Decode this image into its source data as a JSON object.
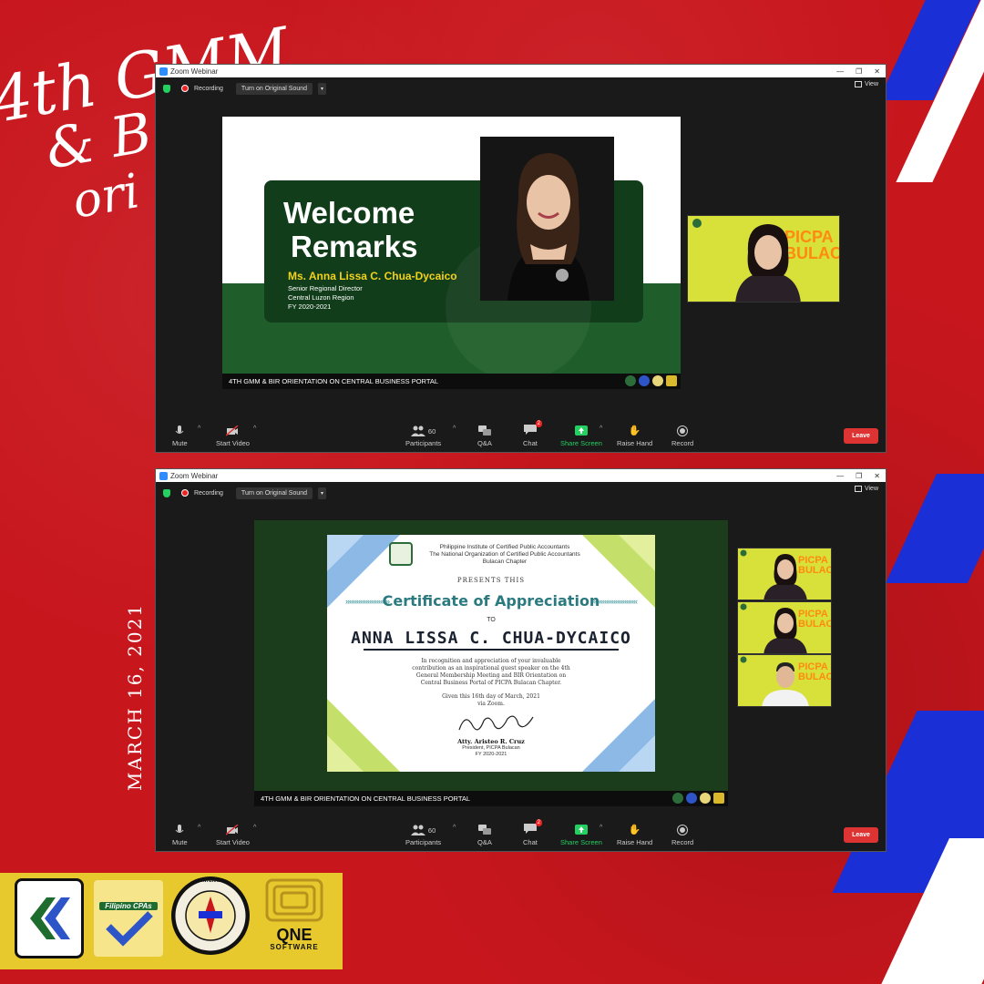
{
  "background": {
    "title_lines": [
      "4th GMM",
      "& B",
      "ori"
    ],
    "date": "MARCH 16, 2021",
    "accent_red": "#c8161d",
    "accent_blue": "#1a2fd6"
  },
  "window_top": {
    "app_title": "Zoom Webinar",
    "recording_label": "Recording",
    "original_sound_label": "Turn on Original Sound",
    "view_label": "View",
    "slide": {
      "heading_line1": "Welcome",
      "heading_line2": "Remarks",
      "speaker_name": "Ms. Anna Lissa C. Chua-Dycaico",
      "speaker_role1": "Senior Regional Director",
      "speaker_role2": "Central Luzon Region",
      "speaker_role3": "FY 2020-2021"
    },
    "banner_text": "4TH GMM & BIR ORIENTATION ON CENTRAL BUSINESS PORTAL",
    "thumb_label": "PICPA BULACAN",
    "toolbar": {
      "mute": "Mute",
      "start_video": "Start Video",
      "participants": "Participants",
      "participant_count": "60",
      "qa": "Q&A",
      "chat": "Chat",
      "chat_badge": "2",
      "share_screen": "Share Screen",
      "raise_hand": "Raise Hand",
      "record": "Record",
      "leave": "Leave"
    }
  },
  "window_bottom": {
    "app_title": "Zoom Webinar",
    "recording_label": "Recording",
    "original_sound_label": "Turn on Original Sound",
    "view_label": "View",
    "certificate": {
      "org_line1": "Philippine Institute of Certified Public Accountants",
      "org_line2": "The National Organization of Certified Public Accountants",
      "org_line3": "Bulacan Chapter",
      "presents": "PRESENTS THIS",
      "title": "Certificate of Appreciation",
      "to": "TO",
      "recipient": "ANNA LISSA C. CHUA-DYCAICO",
      "body_line1": "In recognition and appreciation of your invaluable",
      "body_line2": "contribution as an inspirational guest speaker on the 4th",
      "body_line3": "General Membership Meeting and BIR Orientation on",
      "body_line4": "Central Business Portal of PICPA Bulacan Chapter.",
      "given_line1": "Given this 16th day of March, 2021",
      "given_line2": "via Zoom.",
      "signatory": "Atty. Aristeo R. Cruz",
      "signatory_title": "President, PICPA Bulacan",
      "signatory_fy": "FY 2020-2021"
    },
    "banner_text": "4TH GMM & BIR ORIENTATION ON CENTRAL BUSINESS PORTAL",
    "thumb_label": "PICPA BULACAN",
    "toolbar": {
      "mute": "Mute",
      "start_video": "Start Video",
      "participants": "Participants",
      "participant_count": "60",
      "qa": "Q&A",
      "chat": "Chat",
      "chat_badge": "2",
      "share_screen": "Share Screen",
      "raise_hand": "Raise Hand",
      "record": "Record",
      "leave": "Leave"
    }
  },
  "logos": {
    "filipino_cpas": "Filipino CPAs",
    "bir_seal": "BUREAU OF INTERNAL REVENUE",
    "qne_line1": "QNE",
    "qne_line2": "SOFTWARE"
  }
}
